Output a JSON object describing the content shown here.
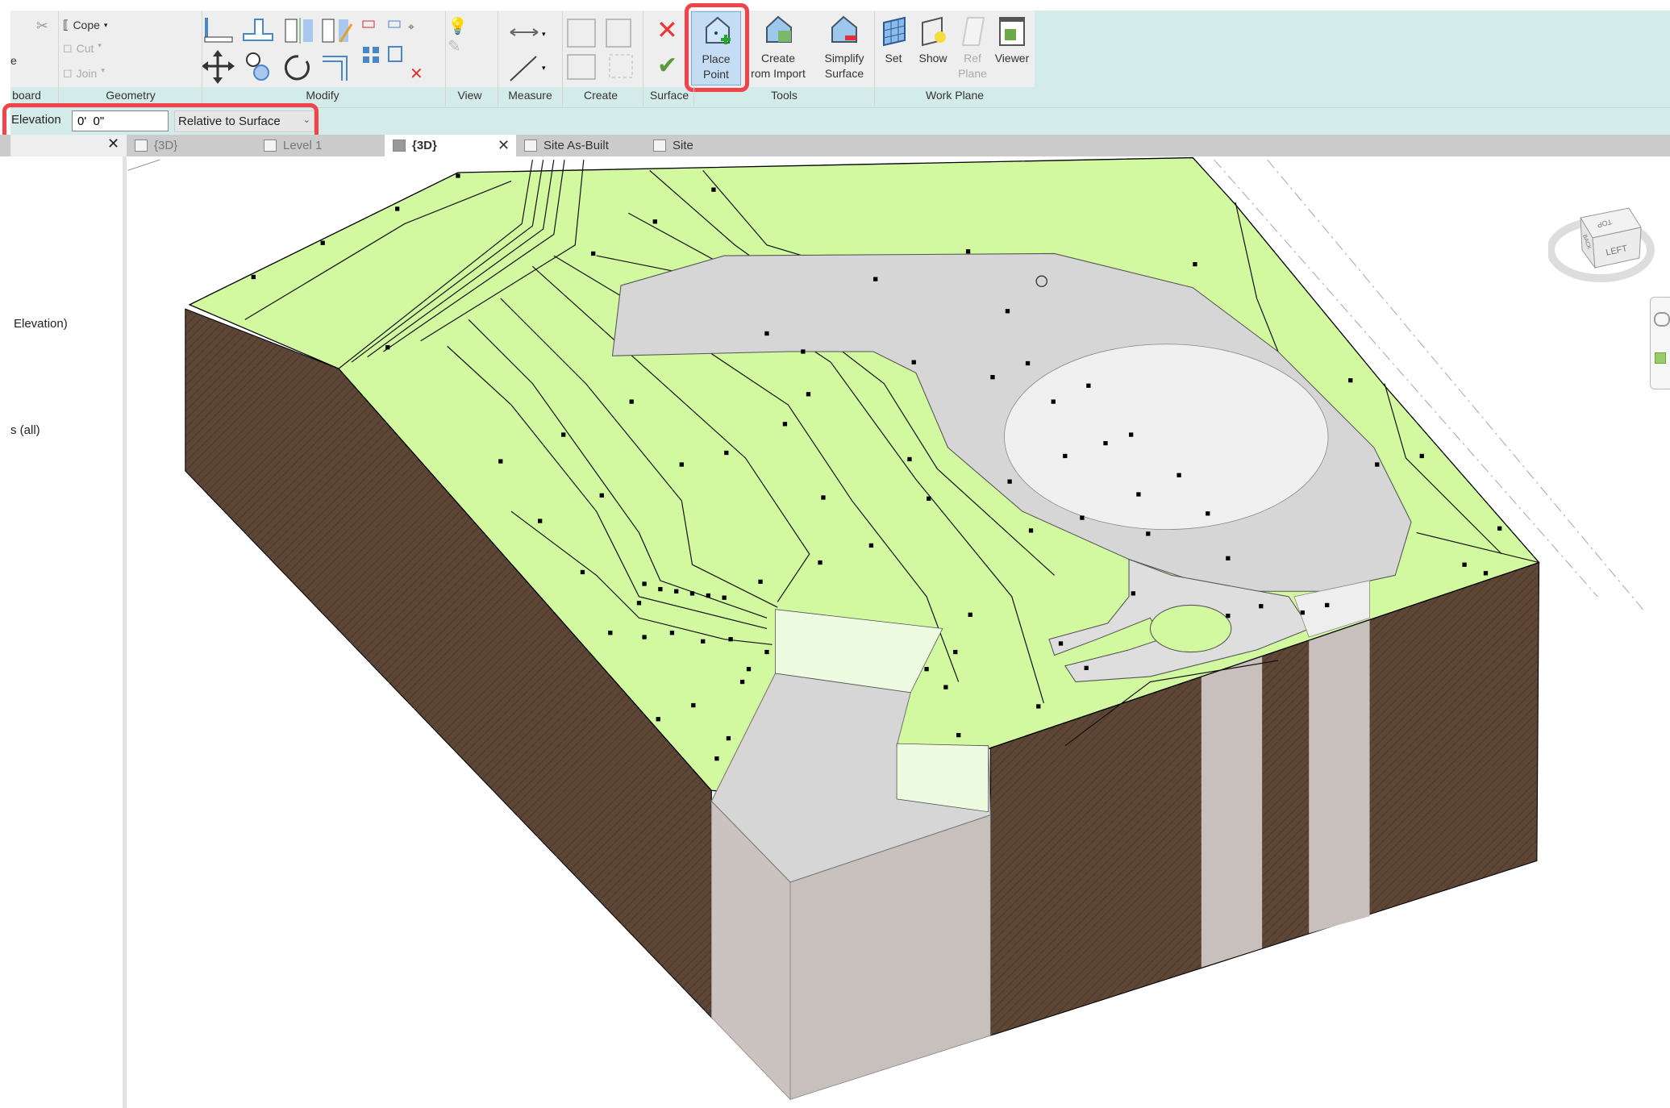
{
  "ribbon": {
    "panels": [
      {
        "label": "board"
      },
      {
        "label": "Geometry"
      },
      {
        "label": "Modify"
      },
      {
        "label": "View"
      },
      {
        "label": "Measure"
      },
      {
        "label": "Create"
      },
      {
        "label": "Surface"
      },
      {
        "label": "Tools"
      },
      {
        "label": "Work Plane"
      }
    ],
    "geometry": {
      "cope": "Cope",
      "cut": "Cut",
      "join": "Join"
    },
    "clipboard_partial": "e",
    "tools": {
      "place_point": [
        "Place",
        "Point"
      ],
      "create_from_import": [
        "Create",
        "rom Import"
      ],
      "simplify_surface": [
        "Simplify",
        "Surface"
      ]
    },
    "work_plane": {
      "set": "Set",
      "show": "Show",
      "ref_plane": [
        "Ref",
        "Plane"
      ],
      "viewer": "Viewer"
    }
  },
  "options_bar": {
    "elevation_label": "Elevation",
    "elevation_value": "0'  0\"",
    "mode_selected": "Relative to Surface"
  },
  "view_tabs": [
    {
      "label": "{3D}",
      "active": false
    },
    {
      "label": "Level 1",
      "active": false
    },
    {
      "label": "{3D}",
      "active": true
    },
    {
      "label": "Site As-Built",
      "active": false
    },
    {
      "label": "Site",
      "active": false
    }
  ],
  "sidebar": {
    "items": [
      "Elevation)",
      "s (all)"
    ]
  },
  "viewcube": {
    "top": "TOP",
    "left": "LEFT",
    "back": "BACK"
  },
  "colors": {
    "highlight": "#f2424a",
    "terrain": "#d2f8a0",
    "soil": "#5e4636",
    "pad": "#d6d6d6",
    "ribbon_accent": "#d4ece9"
  }
}
